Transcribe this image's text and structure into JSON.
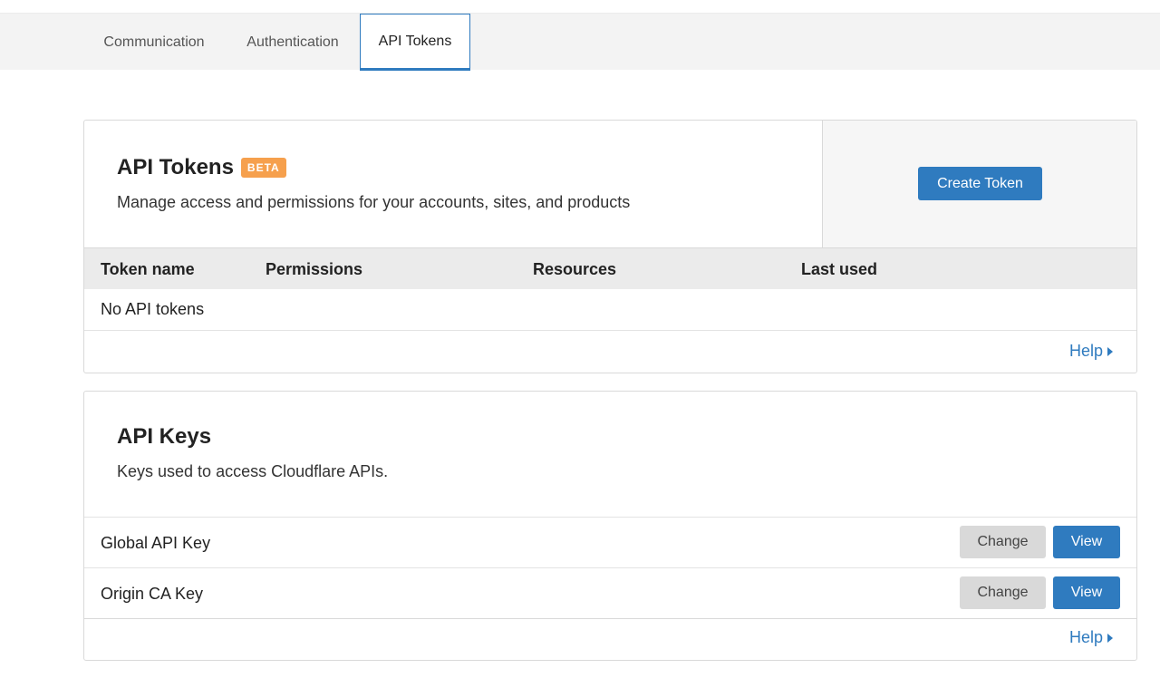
{
  "tabs": [
    {
      "label": "Communication",
      "active": false
    },
    {
      "label": "Authentication",
      "active": false
    },
    {
      "label": "API Tokens",
      "active": true
    }
  ],
  "tokens_card": {
    "title": "API Tokens",
    "badge": "BETA",
    "subtitle": "Manage access and permissions for your accounts, sites, and products",
    "create_button": "Create Token",
    "columns": [
      "Token name",
      "Permissions",
      "Resources",
      "Last used"
    ],
    "empty_text": "No API tokens",
    "help_label": "Help"
  },
  "keys_card": {
    "title": "API Keys",
    "subtitle": "Keys used to access Cloudflare APIs.",
    "rows": [
      {
        "label": "Global API Key",
        "change": "Change",
        "view": "View"
      },
      {
        "label": "Origin CA Key",
        "change": "Change",
        "view": "View"
      }
    ],
    "help_label": "Help"
  },
  "colors": {
    "accent": "#2f7bbf",
    "badge": "#f6a04d",
    "secondary_button": "#d9d9d9"
  },
  "icons": {
    "help_caret": "caret-right-icon"
  }
}
